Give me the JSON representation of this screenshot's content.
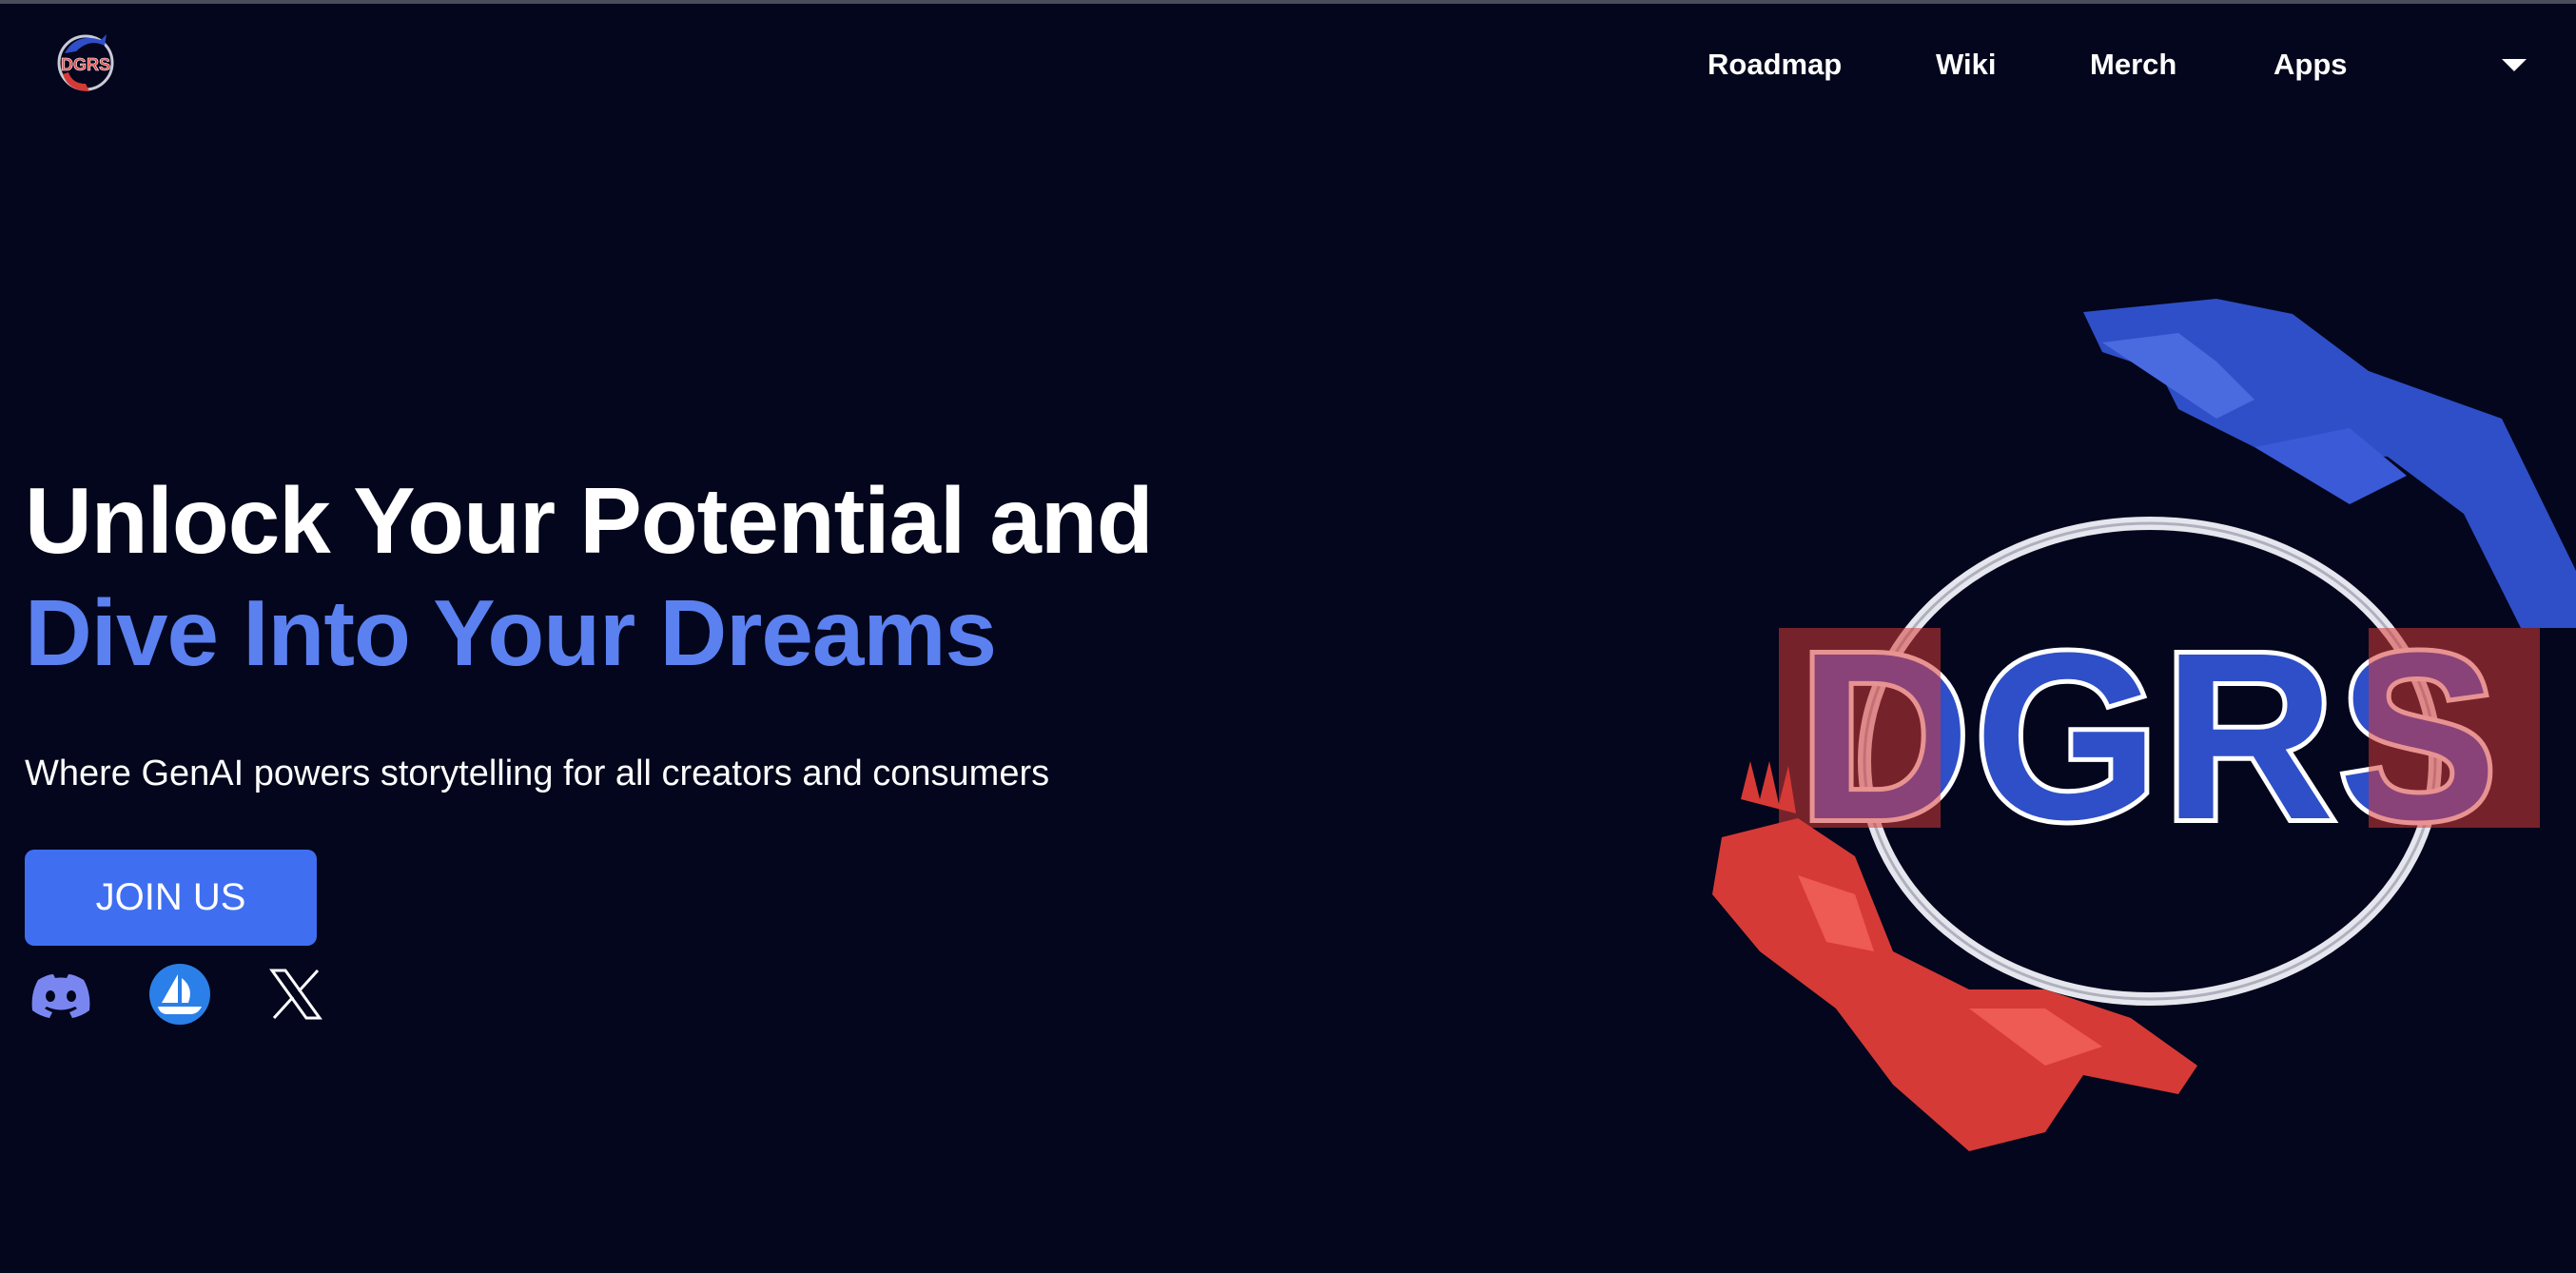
{
  "brand": {
    "logo_text": "DGRS",
    "art_text": "DGRS",
    "accent_blue": "#3f6ff0",
    "headline_blue": "#5b80f0",
    "background": "#03061c",
    "art_red": "#d63a36",
    "art_blue": "#2f4fc8"
  },
  "nav": {
    "items": [
      {
        "label": "Roadmap"
      },
      {
        "label": "Wiki"
      },
      {
        "label": "Merch"
      },
      {
        "label": "Apps"
      }
    ],
    "dropdown_icon": "chevron-down-icon"
  },
  "hero": {
    "headline_line1": "Unlock Your Potential and",
    "headline_line2": "Dive Into Your Dreams",
    "subtitle": "Where GenAI powers storytelling for all creators and consumers",
    "cta_label": "JOIN US"
  },
  "socials": [
    {
      "icon": "discord-icon"
    },
    {
      "icon": "opensea-icon"
    },
    {
      "icon": "x-icon"
    }
  ]
}
